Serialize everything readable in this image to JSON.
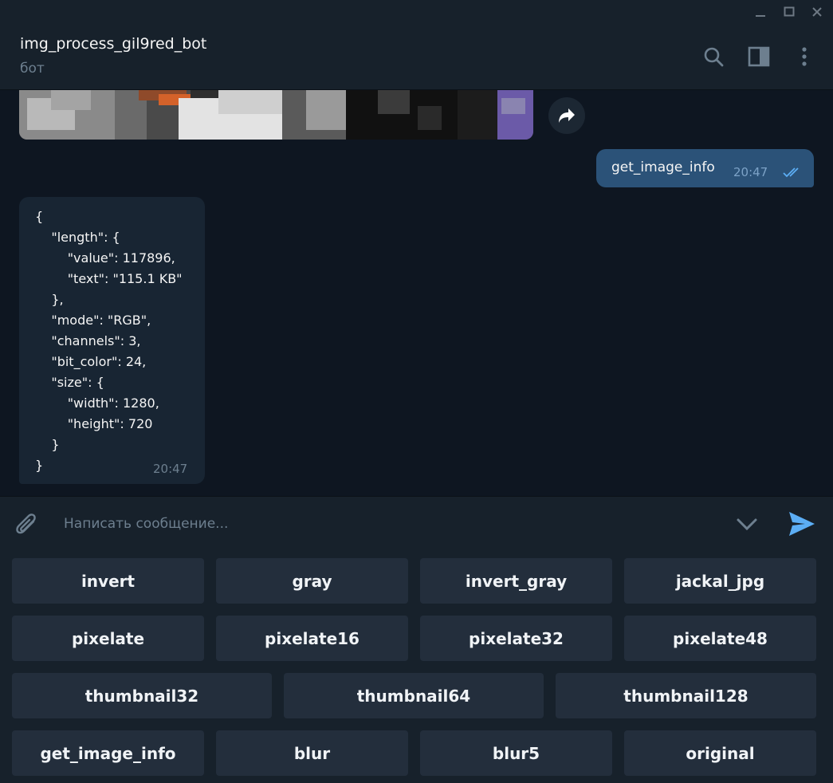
{
  "window": {
    "controls": [
      "minimize-icon",
      "maximize-icon",
      "close-icon"
    ]
  },
  "header": {
    "title": "img_process_gil9red_bot",
    "subtitle": "бот",
    "icons": [
      "search-icon",
      "sidebar-toggle-icon",
      "more-vertical-icon"
    ]
  },
  "messages": {
    "outgoing": {
      "text": "get_image_info",
      "time": "20:47",
      "status": "read"
    },
    "incoming": {
      "text": "{\n    \"length\": {\n        \"value\": 117896,\n        \"text\": \"115.1 KB\"\n    },\n    \"mode\": \"RGB\",\n    \"channels\": 3,\n    \"bit_color\": 24,\n    \"size\": {\n        \"width\": 1280,\n        \"height\": 720\n    }\n}",
      "time": "20:47"
    }
  },
  "composer": {
    "placeholder": "Написать сообщение..."
  },
  "keyboard": {
    "rows": [
      [
        "invert",
        "gray",
        "invert_gray",
        "jackal_jpg"
      ],
      [
        "pixelate",
        "pixelate16",
        "pixelate32",
        "pixelate48"
      ],
      [
        "thumbnail32",
        "thumbnail64",
        "thumbnail128"
      ],
      [
        "get_image_info",
        "blur",
        "blur5",
        "original"
      ]
    ]
  },
  "colors": {
    "background": "#0e1621",
    "panel": "#17212b",
    "outgoing_bubble": "#2b5278",
    "incoming_bubble": "#182533",
    "keyboard_button": "#232e3c",
    "accent": "#5caef5"
  }
}
